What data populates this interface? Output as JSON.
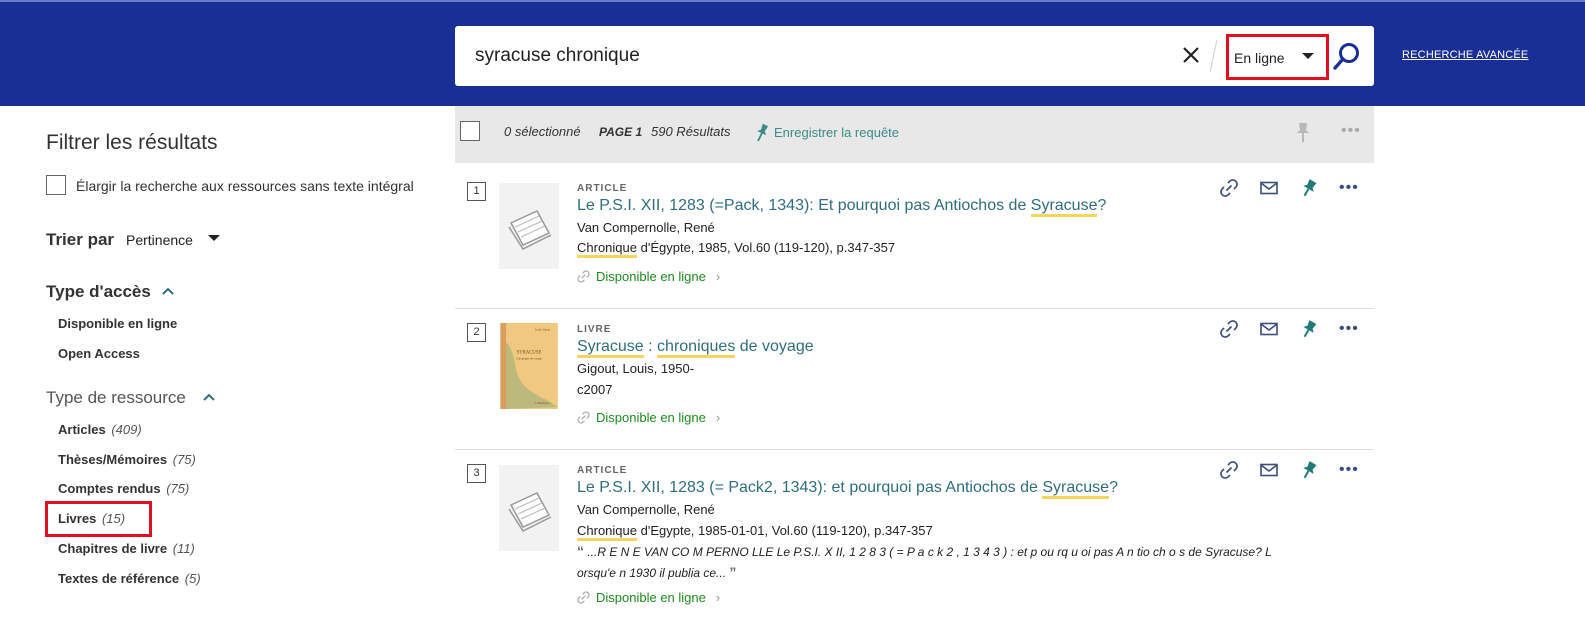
{
  "header": {
    "search_value": "syracuse chronique",
    "scope_value": "En ligne",
    "advanced_search_label": "RECHERCHE AVANCÉE"
  },
  "filters": {
    "title": "Filtrer les résultats",
    "expand_label": "Élargir la recherche aux ressources sans texte intégral",
    "sort_label": "Trier par",
    "sort_value": "Pertinence",
    "access_type": {
      "title": "Type d'accès",
      "items": [
        {
          "label": "Disponible en ligne"
        },
        {
          "label": "Open Access"
        }
      ]
    },
    "resource_type": {
      "title": "Type de ressource",
      "items": [
        {
          "label": "Articles",
          "count": "(409)"
        },
        {
          "label": "Thèses/Mémoires",
          "count": "(75)"
        },
        {
          "label": "Comptes rendus",
          "count": "(75)"
        },
        {
          "label": "Livres",
          "count": "(15)"
        },
        {
          "label": "Chapitres de livre",
          "count": "(11)"
        },
        {
          "label": "Textes de référence",
          "count": "(5)"
        }
      ]
    }
  },
  "toolbar": {
    "selected": "0 sélectionné",
    "page": "PAGE 1",
    "results": "590 Résultats",
    "save_query": "Enregistrer la requête"
  },
  "results": [
    {
      "num": "1",
      "type": "ARTICLE",
      "title_pre": "Le P.S.I. XII, 1283 (=Pack, 1343): Et pourquoi pas Antiochos de ",
      "title_hl": "Syracuse",
      "title_post": "?",
      "author": "Van Compernolle, René",
      "source_hl": "Chronique",
      "source_rest": " d'Égypte, 1985, Vol.60 (119-120), p.347-357",
      "availability": "Disponible en ligne"
    },
    {
      "num": "2",
      "type": "LIVRE",
      "title_hl1": "Syracuse",
      "title_mid": " : ",
      "title_hl2": "chroniques",
      "title_post": " de voyage",
      "author": "Gigout, Louis, 1950-",
      "date": "c2007",
      "availability": "Disponible en ligne",
      "cover_title": "SYRACUSE",
      "cover_subtitle": "Chroniques de voyage",
      "cover_author": "Louis Gigout",
      "cover_publisher": "L'Harmattan"
    },
    {
      "num": "3",
      "type": "ARTICLE",
      "title_pre": "Le P.S.I. XII, 1283 (= Pack2, 1343): et pourquoi pas Antiochos de ",
      "title_hl": "Syracuse",
      "title_post": "?",
      "author": "Van Compernolle, René",
      "source_hl": "Chronique",
      "source_rest": " d'Egypte, 1985-01-01, Vol.60 (119-120), p.347-357",
      "snippet": "...R E N E VAN CO M PERNO LLE Le P.S.I. X II, 1 2 8 3 ( = P a c k 2 , 1 3 4 3 ) : et p ou rq u oi pas A n tio ch o s de Syracuse? L orsqu'e n 1930 il publia ce...",
      "availability": "Disponible en ligne"
    }
  ],
  "colors": {
    "header_bg": "#1a2f96",
    "link_teal": "#2f6e7d",
    "available_green": "#1d8a1d",
    "highlight": "#f5d55e",
    "red_box": "#e0101e"
  }
}
